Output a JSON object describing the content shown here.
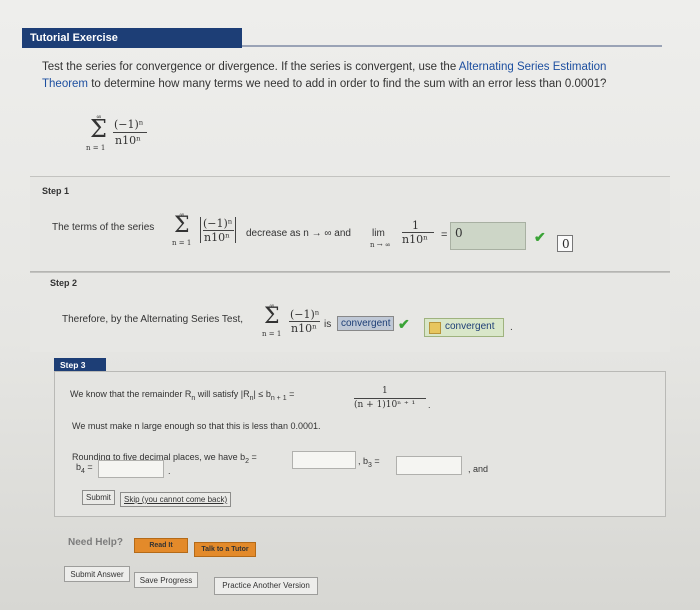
{
  "header": {
    "title": "Tutorial Exercise"
  },
  "problem": {
    "text_before": "Test the series for convergence or divergence. If the series is convergent, use the ",
    "link": "Alternating Series Estimation Theorem",
    "text_after": " to determine how many terms we need to add in order to find the sum with an error less than 0.0001?",
    "series": {
      "upper": "∞",
      "sigma": "Σ",
      "lower": "n = 1",
      "numerator": "(−1)ⁿ",
      "denominator": "n10ⁿ"
    }
  },
  "step1": {
    "label": "Step 1",
    "text_prefix": "The terms of the series",
    "text_middle": "decrease as n → ∞ and",
    "lim": "lim",
    "lim_sub": "n → ∞",
    "frac_num": "1",
    "frac_den": "n10ⁿ",
    "equals": "=",
    "answer_value": "0",
    "check_mark": "✔",
    "boxed_answer": "0"
  },
  "step2": {
    "label": "Step 2",
    "text_prefix": "Therefore, by the Alternating Series Test,",
    "is_text": "is",
    "badge": "convergent",
    "check_mark": "✔",
    "answer": "convergent",
    "period": "."
  },
  "step3": {
    "label": "Step 3",
    "line1_prefix": "We know that the remainder R",
    "line1_sub": "n",
    "line1_mid": " will satisfy |R",
    "line1_mid2": "| ≤ b",
    "line1_sub2": "n + 1",
    "line1_eq": " =",
    "frac_num": "1",
    "frac_den": "(n + 1)10ⁿ ⁺ ¹",
    "line1_end": ".",
    "line2": "We must make n large enough so that this is less than 0.0001.",
    "line3_prefix": "Rounding to five decimal places, we have b",
    "line3_sub": "2",
    "line3_eq": " =",
    "b3_label": ", b",
    "b3_sub": "3",
    "b3_eq": " =",
    "and_text": ", and",
    "b4_label": "b",
    "b4_sub": "4",
    "b4_eq": " =",
    "b2_value": "",
    "b3_value": "",
    "b4_value": "",
    "b4_period": ".",
    "submit_label": "Submit",
    "skip_label": "Skip (you cannot come back)"
  },
  "help": {
    "label": "Need Help?",
    "read_it": "Read It",
    "talk_tutor": "Talk to a Tutor"
  },
  "footer": {
    "submit_answer": "Submit Answer",
    "save_progress": "Save Progress",
    "practice_another": "Practice Another Version"
  },
  "colors": {
    "header_bg": "#1d3e76",
    "link": "#1d4fa0",
    "check": "#3aa336",
    "orange_button": "#e38a2a"
  }
}
